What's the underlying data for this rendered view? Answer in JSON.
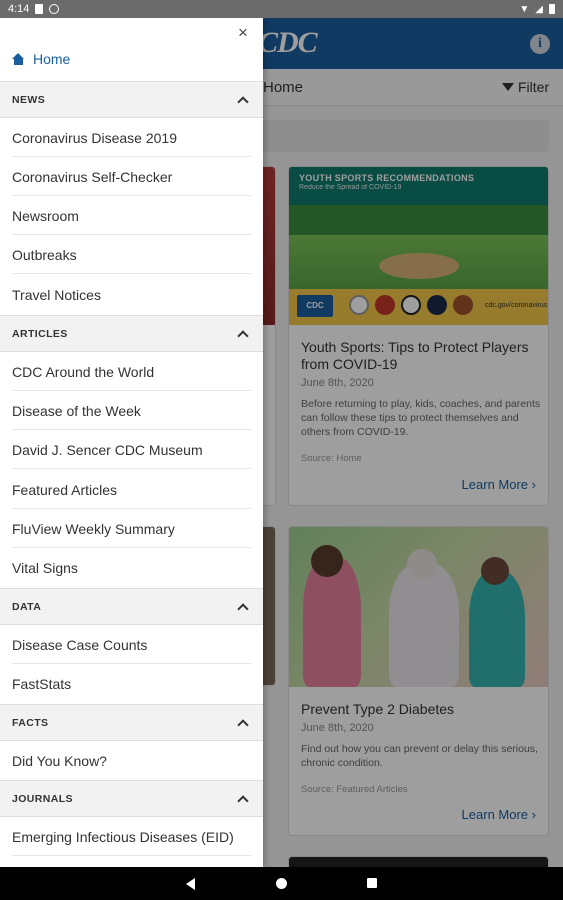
{
  "status_bar": {
    "time": "4:14"
  },
  "app": {
    "logo_text": "CDC",
    "info_icon_glyph": "i",
    "breadcrumb": "Home",
    "filter_label": "Filter",
    "cards": [
      {
        "banner_title": "YOUTH SPORTS RECOMMENDATIONS",
        "banner_subtitle": "Reduce the Spread of COVID-19",
        "banner_logo": "CDC",
        "banner_url": "cdc.gov/coronavirus",
        "title": "Youth Sports: Tips to Protect Players from COVID-19",
        "date": "June 8th, 2020",
        "description": "Before returning to play, kids, coaches, and parents can follow these tips to protect themselves and others from COVID-19.",
        "source": "Source: Home",
        "link": "Learn More"
      },
      {
        "title": "Prevent Type 2 Diabetes",
        "date": "June 8th, 2020",
        "description": "Find out how you can prevent or delay this serious, chronic condition.",
        "source": "Source: Featured Articles",
        "link": "Learn More"
      }
    ]
  },
  "drawer": {
    "close_glyph": "×",
    "home_label": "Home",
    "sections": [
      {
        "label": "NEWS",
        "items": [
          "Coronavirus Disease 2019",
          "Coronavirus Self-Checker",
          "Newsroom",
          "Outbreaks",
          "Travel Notices"
        ]
      },
      {
        "label": "ARTICLES",
        "items": [
          "CDC Around the World",
          "Disease of the Week",
          "David J. Sencer CDC Museum",
          "Featured Articles",
          "FluView Weekly Summary",
          "Vital Signs"
        ]
      },
      {
        "label": "DATA",
        "items": [
          "Disease Case Counts",
          "FastStats"
        ]
      },
      {
        "label": "FACTS",
        "items": [
          "Did You Know?"
        ]
      },
      {
        "label": "JOURNALS",
        "items": [
          "Emerging Infectious Diseases (EID)"
        ]
      }
    ]
  },
  "colors": {
    "brand_blue": "#1a5e9e",
    "drawer_section_bg": "#f2f2f2"
  }
}
